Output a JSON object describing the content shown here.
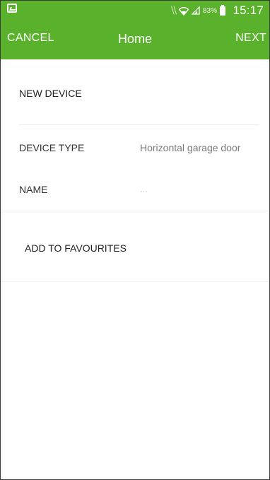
{
  "status_bar": {
    "battery_percent": "83%",
    "time": "15:17",
    "icons": [
      "image-notification-icon",
      "mute-icon",
      "wifi-icon",
      "signal-icon",
      "battery-icon"
    ]
  },
  "app_bar": {
    "cancel_label": "CANCEL",
    "title": "Home",
    "next_label": "NEXT"
  },
  "form": {
    "section_heading": "NEW DEVICE",
    "device_type": {
      "label": "DEVICE TYPE",
      "value": "Horizontal garage door"
    },
    "name": {
      "label": "NAME",
      "value": "..."
    },
    "favourites_label": "ADD TO FAVOURITES"
  },
  "colors": {
    "accent": "#5ab12c"
  }
}
